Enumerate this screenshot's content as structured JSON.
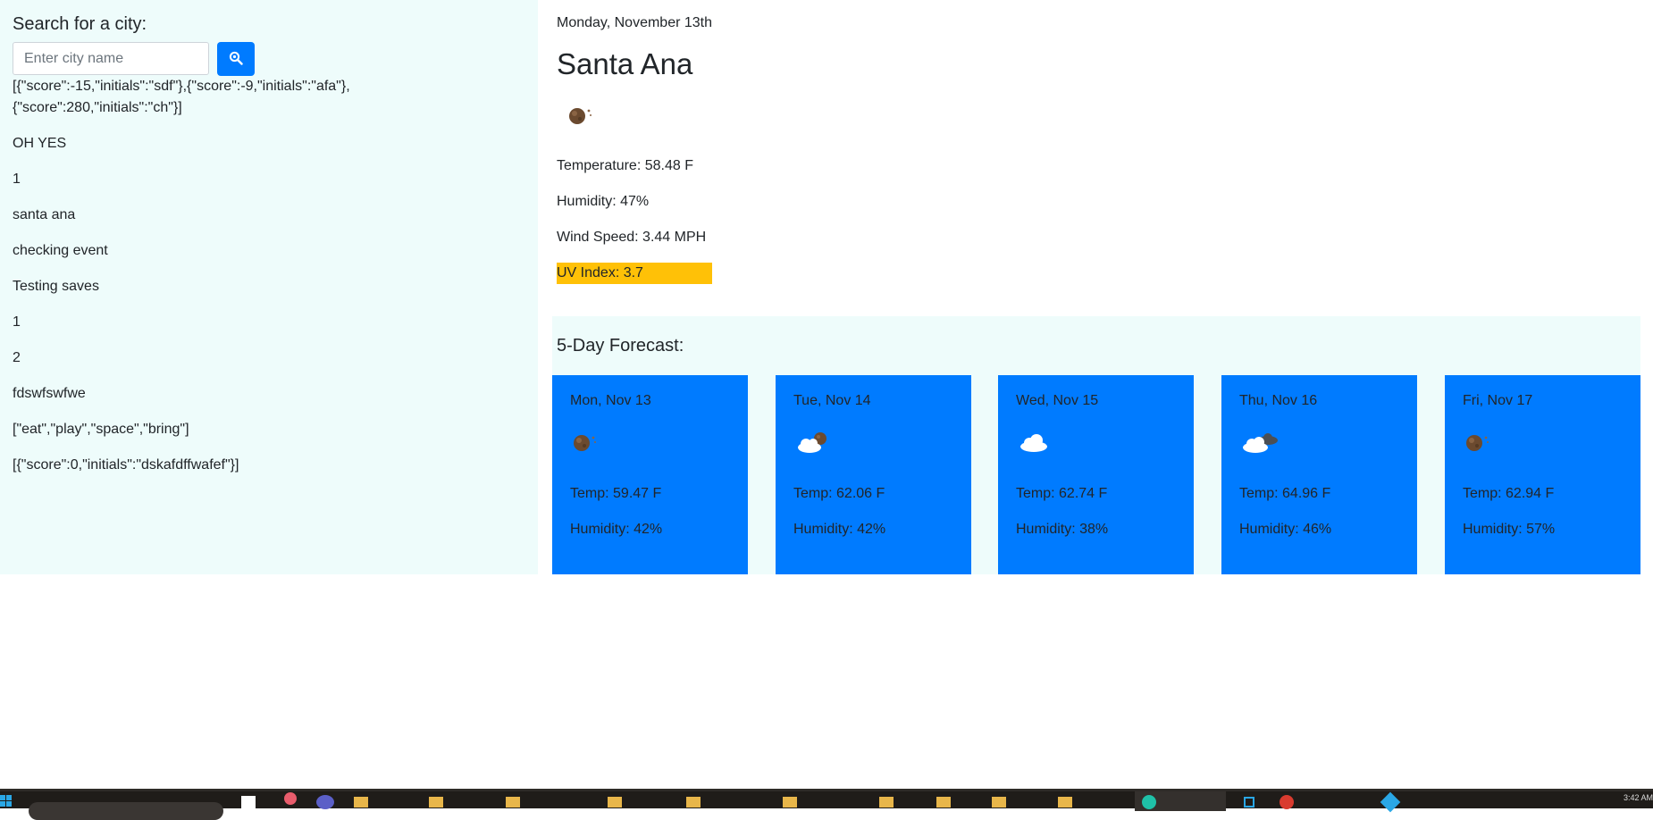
{
  "search": {
    "title": "Search for a city:",
    "placeholder": "Enter city name",
    "value": ""
  },
  "history": [
    "[{\"score\":-15,\"initials\":\"sdf\"},{\"score\":-9,\"initials\":\"afa\"},{\"score\":280,\"initials\":\"ch\"}]",
    "OH YES",
    "1",
    "santa ana",
    "checking event",
    "Testing saves",
    "1",
    "2",
    "fdswfswfwe",
    "[\"eat\",\"play\",\"space\",\"bring\"]",
    "[{\"score\":0,\"initials\":\"dskafdffwafef\"}]"
  ],
  "current": {
    "date": "Monday, November 13th",
    "city": "Santa Ana",
    "icon": "moon-icon",
    "temperature": "Temperature: 58.48 F",
    "humidity": "Humidity: 47%",
    "wind": "Wind Speed: 3.44 MPH",
    "uv": "UV Index: 3.7",
    "uv_color": "#ffc107"
  },
  "forecast": {
    "title": "5-Day Forecast:",
    "card_color": "#007bff",
    "days": [
      {
        "date": "Mon, Nov 13",
        "icon": "moon-icon",
        "temp": "Temp: 59.47 F",
        "humidity": "Humidity: 42%"
      },
      {
        "date": "Tue, Nov 14",
        "icon": "cloud-moon-icon",
        "temp": "Temp: 62.06 F",
        "humidity": "Humidity: 42%"
      },
      {
        "date": "Wed, Nov 15",
        "icon": "cloud-icon",
        "temp": "Temp: 62.74 F",
        "humidity": "Humidity: 38%"
      },
      {
        "date": "Thu, Nov 16",
        "icon": "broken-clouds-icon",
        "temp": "Temp: 64.96 F",
        "humidity": "Humidity: 46%"
      },
      {
        "date": "Fri, Nov 17",
        "icon": "moon-icon",
        "temp": "Temp: 62.94 F",
        "humidity": "Humidity: 57%"
      }
    ]
  },
  "taskbar": {
    "clock": "3:42 AM"
  },
  "colors": {
    "panel_bg": "#eefcfb",
    "accent": "#007bff",
    "uv_moderate": "#ffc107"
  }
}
